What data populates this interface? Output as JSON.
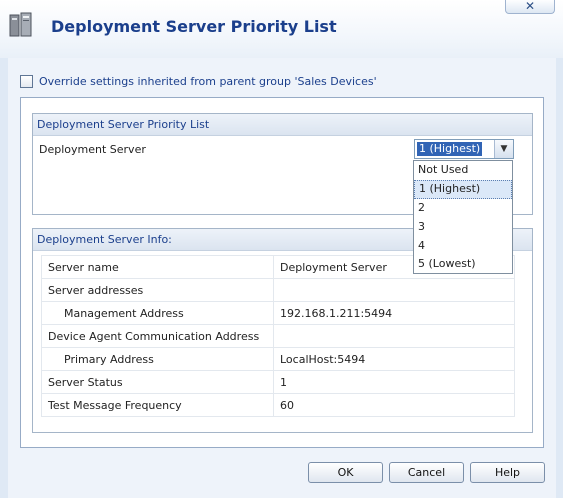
{
  "dialog": {
    "title": "Deployment Server Priority List",
    "close_label": "✕"
  },
  "override": {
    "checked": false,
    "label": "Override settings inherited from parent group 'Sales Devices'"
  },
  "priority_list": {
    "header": "Deployment Server Priority List",
    "server_label": "Deployment Server",
    "selected_value": "1 (Highest)",
    "options": [
      "Not Used",
      "1 (Highest)",
      "2",
      "3",
      "4",
      "5 (Lowest)"
    ]
  },
  "server_info": {
    "header": "Deployment Server Info:",
    "rows": [
      {
        "key": "Server name",
        "value": "Deployment Server"
      },
      {
        "key": "Server addresses",
        "value": ""
      },
      {
        "key": "Management Address",
        "value": "192.168.1.211:5494"
      },
      {
        "key": "Device Agent Communication Address",
        "value": ""
      },
      {
        "key": "Primary Address",
        "value": "LocalHost:5494"
      },
      {
        "key": "Server Status",
        "value": "1"
      },
      {
        "key": "Test Message Frequency",
        "value": "60"
      }
    ]
  },
  "buttons": {
    "ok": "OK",
    "cancel": "Cancel",
    "help": "Help"
  },
  "colors": {
    "title": "#1b3f8c",
    "selection": "#3164b5"
  }
}
